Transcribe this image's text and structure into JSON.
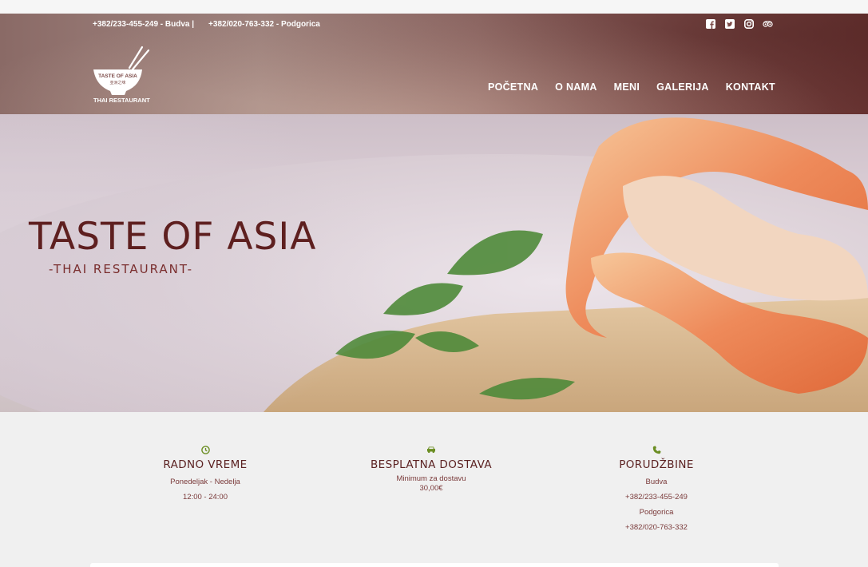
{
  "header": {
    "phone_budva": "+382/233-455-249 - Budva |",
    "phone_podgorica": "+382/020-763-332 - Podgorica",
    "social_icons": [
      "facebook-icon",
      "twitter-icon",
      "instagram-icon",
      "tripadvisor-icon"
    ],
    "logo": {
      "name": "TASTE OF ASIA",
      "subtitle": "THAI RESTAURANT"
    },
    "nav": [
      {
        "label": "POČETNA"
      },
      {
        "label": "O NAMA"
      },
      {
        "label": "MENI"
      },
      {
        "label": "GALERIJA"
      },
      {
        "label": "KONTAKT"
      }
    ]
  },
  "hero": {
    "title": "TASTE OF ASIA",
    "subtitle": "-THAI RESTAURANT-"
  },
  "info": {
    "hours": {
      "icon": "clock-icon",
      "title": "RADNO VREME",
      "days": "Ponedeljak - Nedelja",
      "time": "12:00 - 24:00"
    },
    "delivery": {
      "icon": "car-icon",
      "title": "BESPLATNA DOSTAVA",
      "minimum_label": "Minimum za dostavu",
      "minimum_value": "30,00€"
    },
    "orders": {
      "icon": "phone-icon",
      "title": "PORUDŽBINE",
      "city1": "Budva",
      "phone1": "+382/233-455-249",
      "city2": "Podgorica",
      "phone2": "+382/020-763-332"
    }
  },
  "colors": {
    "brand": "#5e1f1f",
    "icon_green": "#6b8e23",
    "header_text": "#ffffff",
    "page_bg": "#f0f0f0"
  }
}
